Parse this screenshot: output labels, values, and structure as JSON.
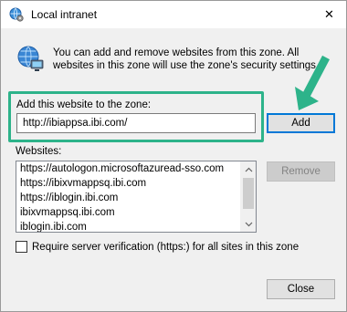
{
  "window": {
    "title": "Local intranet",
    "close_glyph": "✕"
  },
  "intro": {
    "text": "You can add and remove websites from this zone. All websites in this zone will use the zone's security settings."
  },
  "add_section": {
    "label": "Add this website to the zone:",
    "input_value": "http://ibiappsa.ibi.com/",
    "add_button": "Add"
  },
  "websites_section": {
    "label": "Websites:",
    "items": [
      "https://autologon.microsoftazuread-sso.com",
      "https://ibixvmappsq.ibi.com",
      "https://iblogin.ibi.com",
      "ibixvmappsq.ibi.com",
      "iblogin.ibi.com"
    ],
    "remove_button": "Remove"
  },
  "require_verification": {
    "label": "Require server verification (https:) for all sites in this zone",
    "checked": false
  },
  "close_button": "Close",
  "colors": {
    "highlight": "#2db38a",
    "arrow": "#2db38a",
    "add_button_border": "#0078d7"
  },
  "icons": {
    "title_icon": "globe-settings-icon",
    "intro_icon": "intranet-network-icon",
    "arrow": "annotation-arrow-icon"
  }
}
